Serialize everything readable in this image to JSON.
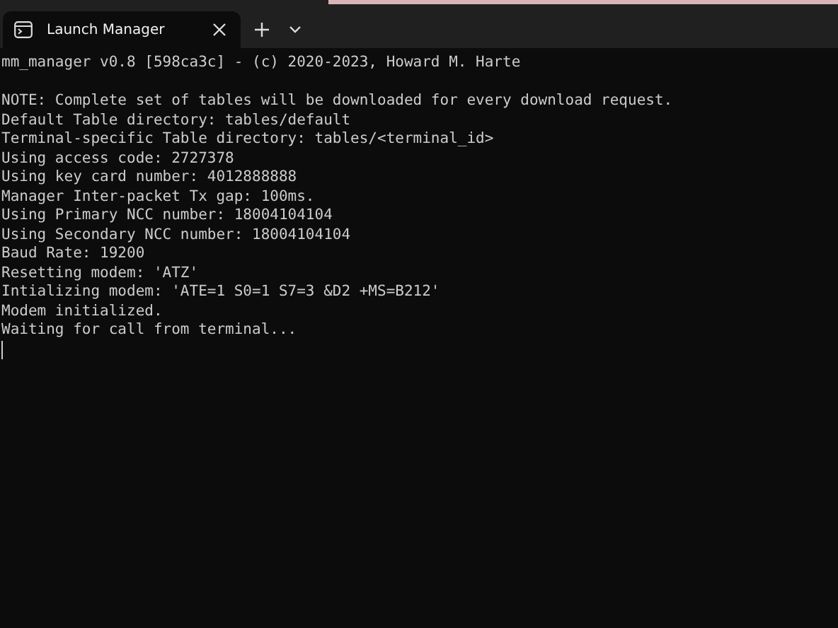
{
  "tab": {
    "title": "Launch Manager",
    "selected": true
  },
  "terminal": {
    "header": "mm_manager v0.8 [598ca3c] - (c) 2020-2023, Howard M. Harte",
    "lines": [
      "NOTE: Complete set of tables will be downloaded for every download request.",
      "Default Table directory: tables/default",
      "Terminal-specific Table directory: tables/<terminal_id>",
      "Using access code: 2727378",
      "Using key card number: 4012888888",
      "Manager Inter-packet Tx gap: 100ms.",
      "Using Primary NCC number: 18004104104",
      "Using Secondary NCC number: 18004104104",
      "Baud Rate: 19200",
      "Resetting modem: 'ATZ'",
      "Intializing modem: 'ATE=1 S0=1 S7=3 &D2 +MS=B212'",
      "Modem initialized.",
      "Waiting for call from terminal..."
    ]
  }
}
